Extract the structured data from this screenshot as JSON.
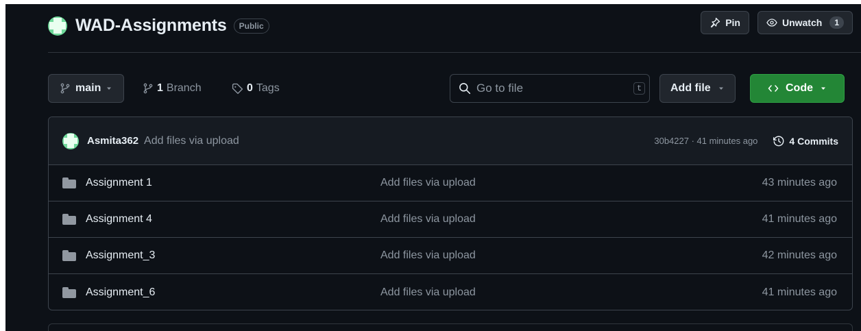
{
  "repo": {
    "name": "WAD-Assignments",
    "visibility": "Public"
  },
  "actions": {
    "pin": "Pin",
    "watch": "Unwatch",
    "watch_count": "1"
  },
  "toolbar": {
    "branch": "main",
    "branch_count": "1",
    "branch_label": "Branch",
    "tag_count": "0",
    "tag_label": "Tags",
    "search_placeholder": "Go to file",
    "search_shortcut": "t",
    "add_file": "Add file",
    "code": "Code"
  },
  "latest_commit": {
    "author": "Asmita362",
    "message": "Add files via upload",
    "meta": "30b4227 · 41 minutes ago",
    "commits_label": "4 Commits"
  },
  "files": [
    {
      "name": "Assignment 1",
      "message": "Add files via upload",
      "time": "43 minutes ago"
    },
    {
      "name": "Assignment 4",
      "message": "Add files via upload",
      "time": "41 minutes ago"
    },
    {
      "name": "Assignment_3",
      "message": "Add files via upload",
      "time": "42 minutes ago"
    },
    {
      "name": "Assignment_6",
      "message": "Add files via upload",
      "time": "41 minutes ago"
    }
  ],
  "colors": {
    "background": "#0d1117",
    "accent_green": "#238636",
    "muted_text": "#8d96a0",
    "border": "#3d444d"
  },
  "icons": [
    "identicon-avatar",
    "pin-icon",
    "eye-icon",
    "git-branch-icon",
    "tag-icon",
    "search-icon",
    "triangle-down-icon",
    "code-icon",
    "history-icon",
    "folder-icon"
  ]
}
